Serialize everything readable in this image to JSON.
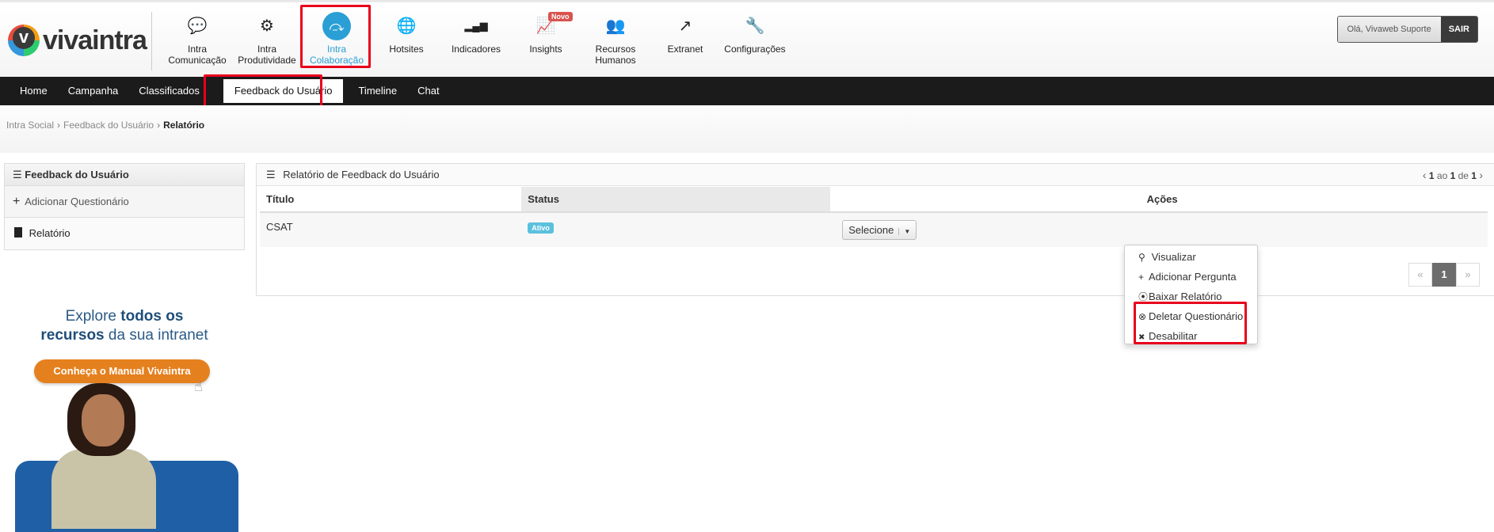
{
  "brand": {
    "name": "vivaintra"
  },
  "modules": [
    {
      "icon": "comments-icon",
      "glyph": "💬",
      "line1": "Intra",
      "line2": "Comunicação"
    },
    {
      "icon": "gears-icon",
      "glyph": "⚙",
      "line1": "Intra",
      "line2": "Produtividade"
    },
    {
      "icon": "share-icon",
      "glyph": "⤼",
      "line1": "Intra",
      "line2": "Colaboração",
      "active": true
    },
    {
      "icon": "globe-icon",
      "glyph": "🌐",
      "line1": "Hotsites",
      "line2": ""
    },
    {
      "icon": "signal-icon",
      "glyph": "▂▄▆",
      "line1": "Indicadores",
      "line2": ""
    },
    {
      "icon": "chart-line-icon",
      "glyph": "📈",
      "line1": "Insights",
      "line2": "",
      "badge": "Novo"
    },
    {
      "icon": "users-icon",
      "glyph": "👥",
      "line1": "Recursos",
      "line2": "Humanos"
    },
    {
      "icon": "external-link-icon",
      "glyph": "↗",
      "line1": "Extranet",
      "line2": ""
    },
    {
      "icon": "wrench-icon",
      "glyph": "🔧",
      "line1": "Configurações",
      "line2": ""
    }
  ],
  "user": {
    "greeting": "Olá, Vivaweb Suporte",
    "logout": "SAIR"
  },
  "nav": {
    "items": [
      "Home",
      "Campanha",
      "Classificados",
      "Feedback do Usuário",
      "Timeline",
      "Chat"
    ],
    "active": "Feedback do Usuário"
  },
  "breadcrumb": {
    "root": "Intra Social",
    "parent": "Feedback do Usuário",
    "current": "Relatório"
  },
  "sidebar": {
    "title": "Feedback do Usuário",
    "items": [
      {
        "icon": "plus-icon",
        "label": "Adicionar Questionário"
      },
      {
        "icon": "file-icon",
        "label": "Relatório"
      }
    ]
  },
  "banner": {
    "line1_a": "Explore ",
    "line1_b": "todos os",
    "line2_a": "recursos",
    "line2_b": " da sua intranet",
    "button": "Conheça o Manual Vivaintra"
  },
  "report": {
    "title": "Relatório de Feedback do Usuário",
    "pager_text": {
      "from": "1",
      "sep1": " ao ",
      "to": "1",
      "sep2": " de ",
      "total": "1"
    },
    "columns": {
      "title": "Título",
      "status": "Status",
      "actions": "Ações"
    },
    "rows": [
      {
        "title": "CSAT",
        "status": "Ativo",
        "action_button": "Selecione"
      }
    ],
    "pagination": {
      "prev": "«",
      "current": "1",
      "next": "»"
    }
  },
  "actions_menu": [
    {
      "icon": "search-icon",
      "glyph": "🔍",
      "label": "Visualizar"
    },
    {
      "icon": "plus-icon",
      "glyph": "+",
      "label": "Adicionar Pergunta"
    },
    {
      "icon": "download-circle-icon",
      "glyph": "⦿",
      "label": "Baixar Relatório"
    },
    {
      "icon": "times-circle-icon",
      "glyph": "⊗",
      "label": "Deletar Questionário"
    },
    {
      "icon": "times-circle-solid-icon",
      "glyph": "✖",
      "label": "Desabilitar"
    }
  ],
  "colors": {
    "accent": "#2a9fd6",
    "highlight": "#e8001c",
    "navbar": "#1b1b1b",
    "banner_orange": "#e5801f"
  }
}
